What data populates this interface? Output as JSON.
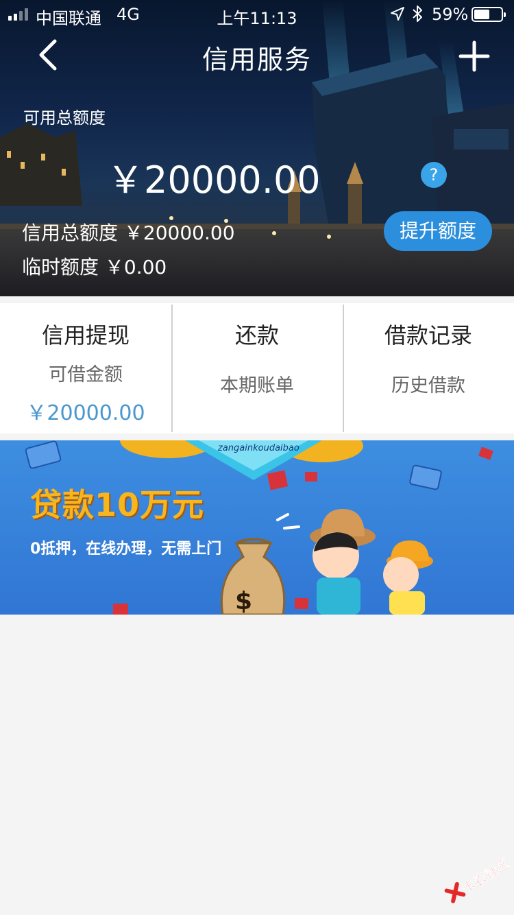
{
  "status_bar": {
    "carrier": "中国联通",
    "network": "4G",
    "time": "上午11:13",
    "battery_percent": "59%",
    "battery_level": 0.59,
    "icons": [
      "signal-icon",
      "location-icon",
      "bluetooth-icon",
      "battery-icon"
    ]
  },
  "nav": {
    "title": "信用服务",
    "back_icon": "chevron-left-icon",
    "add_icon": "plus-icon"
  },
  "credit": {
    "available_label": "可用总额度",
    "available_amount": "￥20000.00",
    "help_symbol": "?",
    "total_line": "信用总额度 ￥20000.00",
    "temp_line": "临时额度 ￥0.00",
    "raise_button": "提升额度"
  },
  "actions": [
    {
      "title": "信用提现",
      "subtitle": "可借金额",
      "amount": "￥20000.00"
    },
    {
      "title": "还款",
      "subtitle": "本期账单"
    },
    {
      "title": "借款记录",
      "subtitle": "历史借款"
    }
  ],
  "banner": {
    "pinyin": "zangainkoudaibao",
    "title": "贷款10万元",
    "subtitle": "0抵押，在线办理，无需上门"
  },
  "watermark": {
    "text": "卡农社区"
  },
  "colors": {
    "accent_blue": "#2c8fde",
    "amount_blue": "#4a97cf",
    "banner_blue": "#3d8ee0",
    "banner_gold": "#f7b61e",
    "watermark_red": "#e32a2a"
  }
}
